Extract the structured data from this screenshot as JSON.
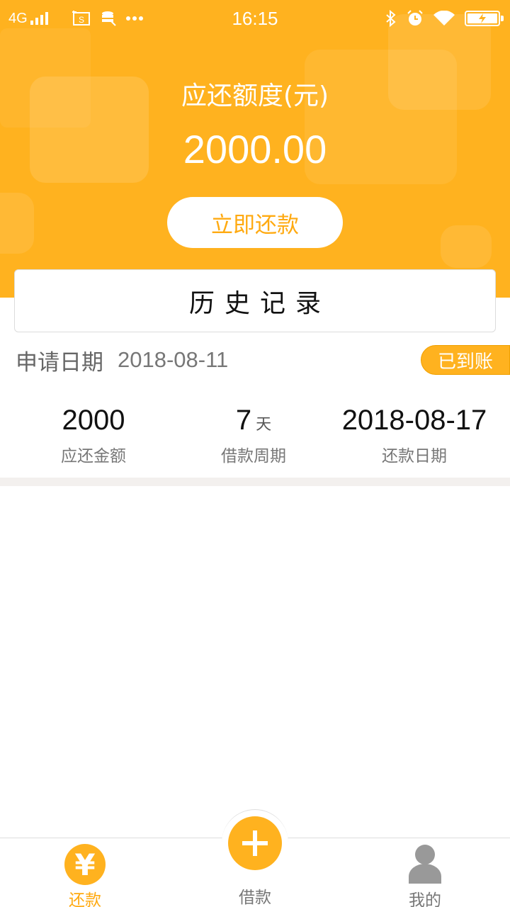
{
  "status_bar": {
    "carrier": "4G",
    "time": "16:15"
  },
  "header": {
    "label": "应还额度(元)",
    "amount": "2000.00",
    "repay_button": "立即还款"
  },
  "history": {
    "title": "历史记录"
  },
  "record": {
    "apply_label": "申请日期",
    "apply_date": "2018-08-11",
    "status": "已到账",
    "stats": [
      {
        "value": "2000",
        "unit": "",
        "caption": "应还金额"
      },
      {
        "value": "7",
        "unit": "天",
        "caption": "借款周期"
      },
      {
        "value": "2018-08-17",
        "unit": "",
        "caption": "还款日期"
      }
    ]
  },
  "tabbar": {
    "repay": {
      "icon": "yen-icon",
      "glyph": "¥",
      "label": "还款"
    },
    "borrow": {
      "icon": "plus-icon",
      "label": "借款"
    },
    "me": {
      "icon": "user-icon",
      "label": "我的"
    }
  },
  "colors": {
    "brand": "#ffb21f",
    "brand_text": "#ffaa11",
    "divider": "#f3f0ee"
  }
}
